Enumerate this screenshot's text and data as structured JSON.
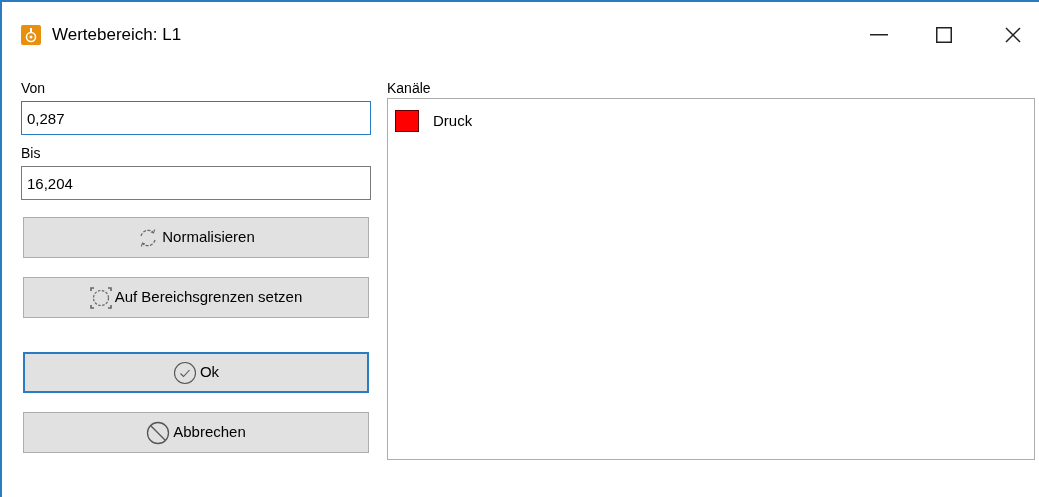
{
  "window": {
    "title": "Wertebereich: L1"
  },
  "fields": [
    {
      "label": "Von",
      "value": "0,287",
      "focused": true
    },
    {
      "label": "Bis",
      "value": "16,204",
      "focused": false
    }
  ],
  "buttons": [
    {
      "label": "Normalisieren",
      "kind": "normalize",
      "focused": false
    },
    {
      "label": "Auf Bereichsgrenzen setzen",
      "kind": "limits",
      "focused": false
    },
    {
      "label": "Ok",
      "kind": "confirm",
      "focused": true
    },
    {
      "label": "Abbrechen",
      "kind": "abort",
      "focused": false
    }
  ],
  "channels_label": "Kanäle",
  "channels": [
    {
      "name": "Druck",
      "color": "#ff0000"
    }
  ]
}
